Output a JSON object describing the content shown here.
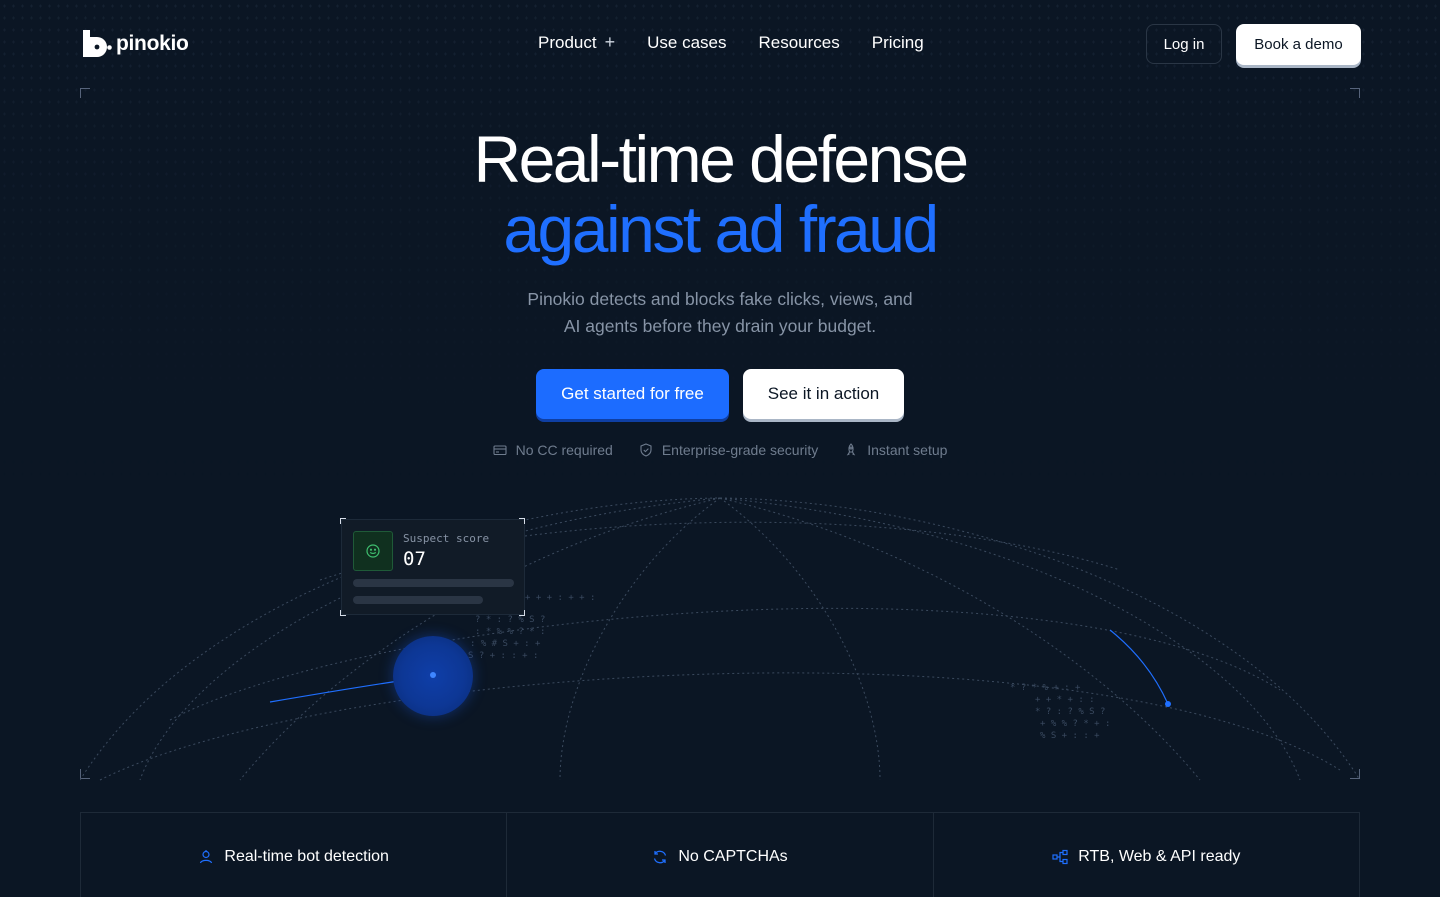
{
  "brand": {
    "name": "pinokio"
  },
  "nav": {
    "items": [
      {
        "label": "Product",
        "has_expand": true
      },
      {
        "label": "Use cases"
      },
      {
        "label": "Resources"
      },
      {
        "label": "Pricing"
      }
    ],
    "login_label": "Log in",
    "demo_label": "Book a demo"
  },
  "hero": {
    "title_line1": "Real-time defense",
    "title_line2": "against ad fraud",
    "subtitle_line1": "Pinokio detects and blocks fake clicks, views, and",
    "subtitle_line2": "AI agents before they drain your budget.",
    "cta_primary": "Get started for free",
    "cta_secondary": "See it in action",
    "badges": [
      {
        "icon": "credit-card-icon",
        "label": "No CC required"
      },
      {
        "icon": "shield-icon",
        "label": "Enterprise-grade security"
      },
      {
        "icon": "rocket-icon",
        "label": "Instant setup"
      }
    ]
  },
  "score_card": {
    "label": "Suspect score",
    "value": "07",
    "icon": "smiley-icon"
  },
  "features": [
    {
      "icon": "bot-icon",
      "label": "Real-time bot detection"
    },
    {
      "icon": "refresh-icon",
      "label": "No CAPTCHAs"
    },
    {
      "icon": "network-icon",
      "label": "RTB, Web & API ready"
    }
  ],
  "colors": {
    "background": "#0b1624",
    "accent": "#1f6fff",
    "muted_text": "#8794a6",
    "score_green": "#3fbf6f"
  }
}
